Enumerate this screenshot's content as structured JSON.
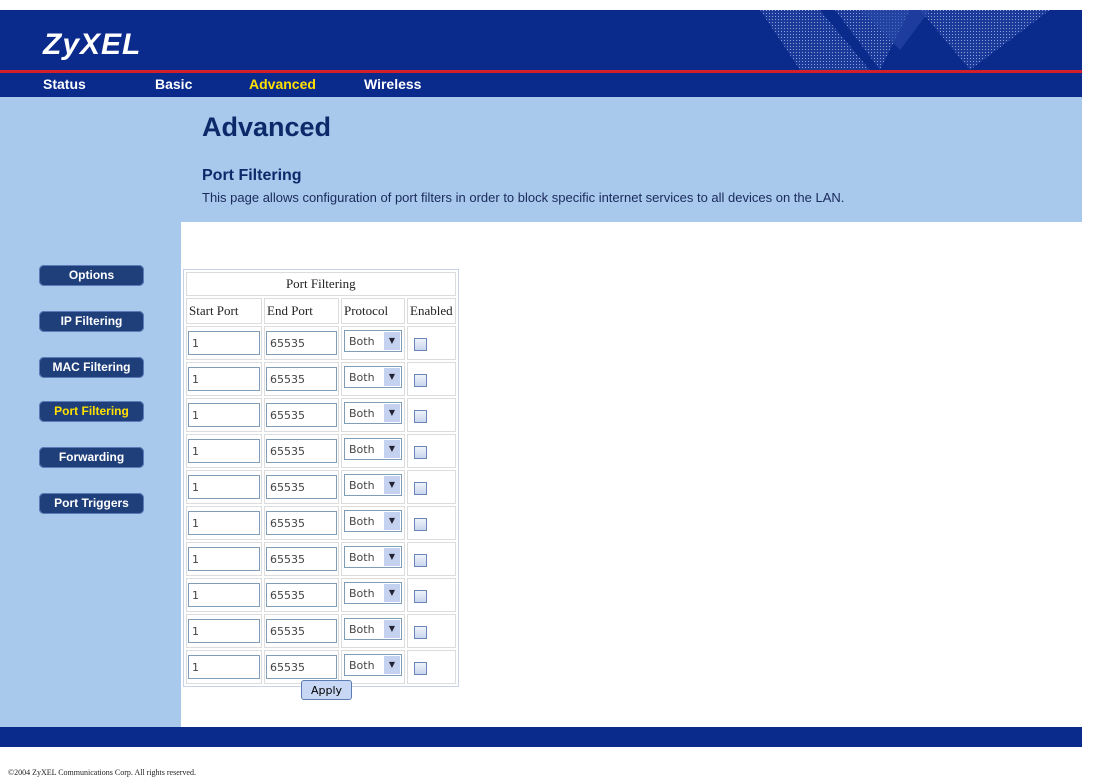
{
  "brand": {
    "logo": "ZyXEL"
  },
  "nav": {
    "tabs": [
      {
        "label": "Status"
      },
      {
        "label": "Basic"
      },
      {
        "label": "Advanced",
        "active": true
      },
      {
        "label": "Wireless"
      }
    ]
  },
  "header": {
    "title": "Advanced",
    "section_title": "Port Filtering",
    "section_desc": "This page allows configuration of port filters in order to block specific internet services to all devices on the LAN."
  },
  "sidebar": {
    "items": [
      {
        "label": "Options"
      },
      {
        "label": "IP Filtering"
      },
      {
        "label": "MAC Filtering"
      },
      {
        "label": "Port Filtering",
        "active": true
      },
      {
        "label": "Forwarding"
      },
      {
        "label": "Port Triggers"
      }
    ]
  },
  "table": {
    "caption": "Port Filtering",
    "columns": [
      "Start Port",
      "End Port",
      "Protocol",
      "Enabled"
    ],
    "rows": [
      {
        "start": "1",
        "end": "65535",
        "protocol": "Both",
        "enabled": false
      },
      {
        "start": "1",
        "end": "65535",
        "protocol": "Both",
        "enabled": false
      },
      {
        "start": "1",
        "end": "65535",
        "protocol": "Both",
        "enabled": false
      },
      {
        "start": "1",
        "end": "65535",
        "protocol": "Both",
        "enabled": false
      },
      {
        "start": "1",
        "end": "65535",
        "protocol": "Both",
        "enabled": false
      },
      {
        "start": "1",
        "end": "65535",
        "protocol": "Both",
        "enabled": false
      },
      {
        "start": "1",
        "end": "65535",
        "protocol": "Both",
        "enabled": false
      },
      {
        "start": "1",
        "end": "65535",
        "protocol": "Both",
        "enabled": false
      },
      {
        "start": "1",
        "end": "65535",
        "protocol": "Both",
        "enabled": false
      },
      {
        "start": "1",
        "end": "65535",
        "protocol": "Both",
        "enabled": false
      }
    ]
  },
  "apply_label": "Apply",
  "footer": {
    "copyright": "©2004 ZyXEL Communications Corp.   All rights reserved."
  },
  "colors": {
    "header_bg": "#0a2a8c",
    "accent_red": "#d4202a",
    "sidebar_bg": "#a8c8ec",
    "active_text": "#ffe000"
  }
}
